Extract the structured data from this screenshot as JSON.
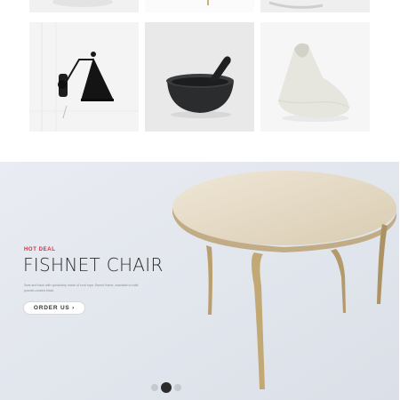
{
  "products_top": [
    {
      "name": "product-tile-1"
    },
    {
      "name": "product-tile-2"
    },
    {
      "name": "product-tile-3"
    }
  ],
  "products": [
    {
      "icon": "wall-lamp"
    },
    {
      "icon": "mortar-and-pestle"
    },
    {
      "icon": "white-vase"
    }
  ],
  "hero": {
    "eyebrow": "HOT DEAL",
    "title": "FISHNET CHAIR",
    "description": "Seat and back with upholstery made of cord rope. Beech frame, available in matt powder-coated black.",
    "button_label": "ORDER US ›",
    "slides": 3,
    "active_slide": 2
  },
  "colors": {
    "accent": "#d6303b",
    "hero_bg": "#e3e7ee",
    "dot_active": "#2b2b2b",
    "dot_inactive": "#c4c8cf"
  }
}
